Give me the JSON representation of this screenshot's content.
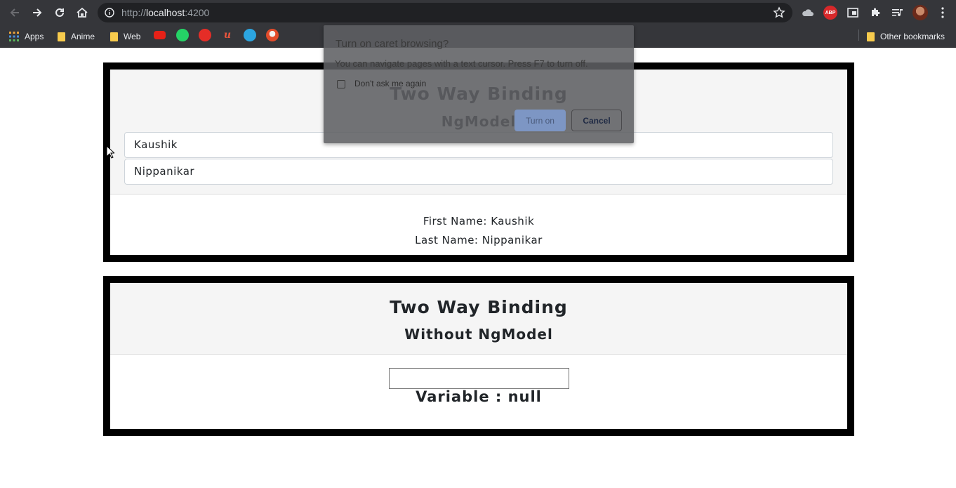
{
  "browser": {
    "url_scheme": "http://",
    "url_host": "localhost",
    "url_port": ":4200",
    "bookmarks": [
      "Apps",
      "Anime",
      "Web"
    ],
    "other_bookmarks": "Other bookmarks",
    "extension_abp": "ABP"
  },
  "card1": {
    "title": "Two Way Binding",
    "subtitle": "NgModel",
    "first_name_value": "Kaushik",
    "last_name_value": "Nippanikar",
    "first_name_line": "First Name: Kaushik",
    "last_name_line": "Last Name: Nippanikar"
  },
  "card2": {
    "title": "Two Way Binding",
    "subtitle": "Without NgModel",
    "input_value": "",
    "variable_line": "Variable : null"
  },
  "dialog": {
    "title": "Turn on caret browsing?",
    "message": "You can navigate pages with a text cursor. Press F7 to turn off.",
    "checkbox_label": "Don't ask me again",
    "turn_on": "Turn on",
    "cancel": "Cancel"
  },
  "colors": {
    "chrome_bg": "#35363a",
    "omnibox_bg": "#202124",
    "card_border": "#000000",
    "card_header_bg": "#f5f5f5",
    "text": "#212529",
    "folder": "#f7cb4d"
  }
}
